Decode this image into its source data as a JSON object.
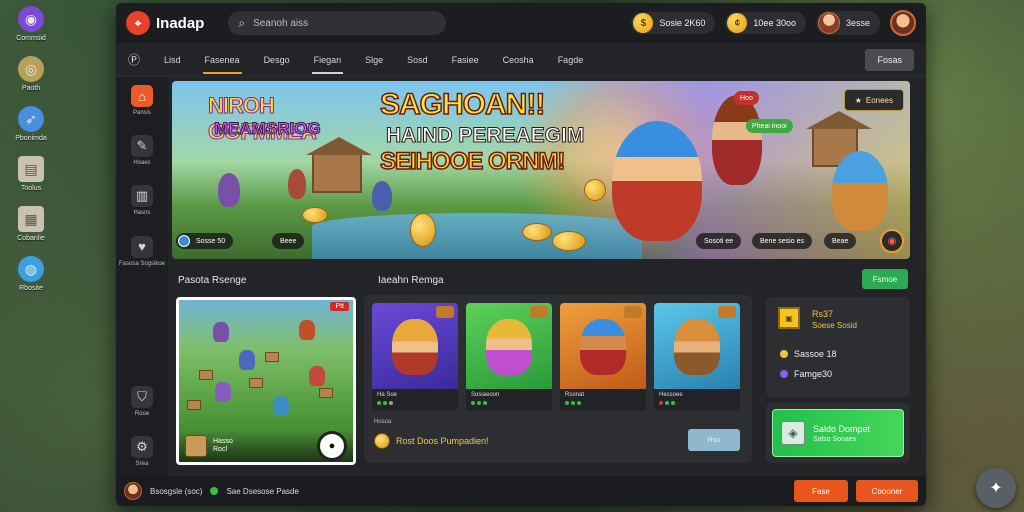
{
  "desktop": {
    "icons": [
      {
        "label": "Commsid",
        "icon": "discord-icon",
        "color": "#7b4bd8"
      },
      {
        "label": "Paoth",
        "icon": "clash-icon",
        "color": "#b8a05a"
      },
      {
        "label": "Pbonimda",
        "icon": "compass-icon",
        "color": "#4a8ee0"
      },
      {
        "label": "Toolus",
        "icon": "box-icon",
        "color": "#c9c2b0"
      },
      {
        "label": "Cobanlie",
        "icon": "crate-icon",
        "color": "#c9c2b0"
      },
      {
        "label": "Rbosite",
        "icon": "globe-icon",
        "color": "#3aa0e0"
      }
    ]
  },
  "app": {
    "name": "Inadap",
    "search": {
      "placeholder": "Seanoh aiss"
    },
    "wallets": [
      {
        "label": "Sosie 2K60",
        "icon": "gold-coin-icon"
      },
      {
        "label": "10ee 30oo",
        "icon": "gold-coin-icon"
      },
      {
        "label": "3esse",
        "icon": "avatar-icon"
      }
    ]
  },
  "nav": {
    "first": "Ⓟ",
    "tabs": [
      "Lisd",
      "Fasenea",
      "Desgo",
      "Fiegan",
      "Slge",
      "Sosd",
      "Fasiee",
      "Ceosha",
      "Fagde"
    ],
    "active_index": 1,
    "selected_index": 3,
    "button": "Fosas"
  },
  "sidebar": {
    "items": [
      {
        "label": "Pansis",
        "icon": "home-icon",
        "active": true
      },
      {
        "label": "Hoaes",
        "icon": "pencil-icon",
        "active": false
      },
      {
        "label": "Hasns",
        "icon": "book-icon",
        "active": false
      },
      {
        "label": "Fasosa Sogsikoe",
        "icon": "heart-icon",
        "active": false
      }
    ],
    "bottom": [
      {
        "label": "Rooe",
        "icon": "shield-icon"
      },
      {
        "label": "Srea",
        "icon": "settings-icon"
      }
    ]
  },
  "hero": {
    "logo_line1": "NIROH GOFMMEA",
    "logo_line2": "MEAMSRIOG",
    "line1": "SAGHOAN!!",
    "line2": "HAIND PEREAEGIM",
    "line3": "SEIHOOE ORNM!",
    "button": "Eonees",
    "chip_red": "Hoo",
    "chip_green": "Pheai inooi",
    "pills": [
      "Sosse 50",
      "Beee",
      "Sosoti ee",
      "Bene sesio es",
      "Beae"
    ],
    "colors": {
      "gold": "#ffe23a",
      "accent": "#d95df0"
    }
  },
  "sections": {
    "left_title": "Pasota Rsenge",
    "right_title": "Iaeahn Remga",
    "right_button": "Fsmoe"
  },
  "featured": {
    "badge": "Ptt",
    "text1": "Hasso",
    "text2": "Rocl",
    "play": "●"
  },
  "games": [
    {
      "title": "Ha Soe",
      "dots": [
        "#2fbf4a",
        "#2fbf4a",
        "#9a9a9a"
      ],
      "bg": "#5b3ec7",
      "face": "#e6a93a"
    },
    {
      "title": "Sosiaeoon",
      "dots": [
        "#2fbf4a",
        "#2fbf4a",
        "#2fbf4a"
      ],
      "bg": "#4dc04a",
      "face": "#c04fd0"
    },
    {
      "title": "Rsonat",
      "dots": [
        "#2fbf4a",
        "#2fbf4a",
        "#2fbf4a"
      ],
      "bg": "#e87a2a",
      "face": "#d24a3a"
    },
    {
      "title": "Hessoee",
      "dots": [
        "#d03a3a",
        "#2fbf4a",
        "#2fbf4a"
      ],
      "bg": "#3ab0d8",
      "face": "#d88e3a"
    }
  ],
  "promo": {
    "label": "Hosoa",
    "text": "Rost Doos Pumpadien!",
    "button": "Rso"
  },
  "stats": {
    "line1": "Rs37",
    "line2": "Soese Sosid",
    "rows": [
      {
        "label": "Sassoe 18",
        "color": "#f3c43a"
      },
      {
        "label": "Famge30",
        "color": "#8b5cf0"
      }
    ]
  },
  "save": {
    "title": "Saldo Dompet",
    "subtitle": "Salso Sooaes"
  },
  "footer": {
    "user": "Bsosgsle (soc)",
    "status": "Sae Dsesose Pasde",
    "btn1": "Fase",
    "btn2": "Coooner"
  }
}
